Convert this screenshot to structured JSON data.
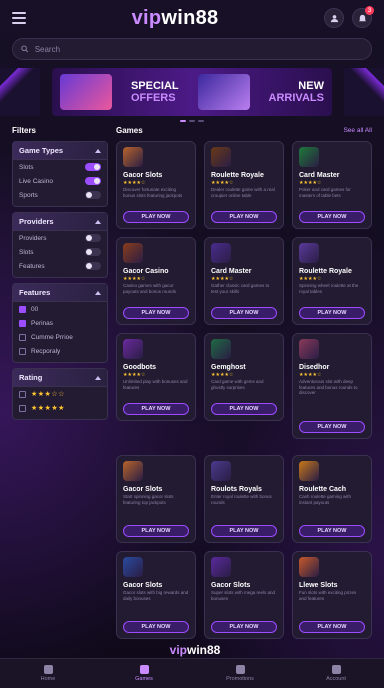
{
  "header": {
    "logo_a": "vip",
    "logo_b": "win88",
    "notif_count": "3"
  },
  "search": {
    "placeholder": "Search"
  },
  "banner": {
    "left_line1": "SPECIAL",
    "left_line2": "OFFERS",
    "right_line1": "NEW",
    "right_line2": "ARRIVALS"
  },
  "filters": {
    "title": "Filters",
    "game_types": {
      "title": "Game Types",
      "items": [
        {
          "label": "Slots",
          "on": true
        },
        {
          "label": "Live Casino",
          "on": true
        },
        {
          "label": "Sports",
          "on": false
        }
      ]
    },
    "providers": {
      "title": "Providers",
      "items": [
        {
          "label": "Providers",
          "on": false
        },
        {
          "label": "Slots",
          "on": false
        },
        {
          "label": "Features",
          "on": false
        }
      ]
    },
    "features": {
      "title": "Features",
      "items": [
        {
          "label": "00",
          "checked": true
        },
        {
          "label": "Perinas",
          "checked": true
        },
        {
          "label": "Cumme Prrioe",
          "checked": false
        },
        {
          "label": "Recporaly",
          "checked": false
        }
      ]
    },
    "rating": {
      "title": "Rating",
      "items": [
        {
          "stars": "★★★☆☆"
        },
        {
          "stars": "★★★★★"
        }
      ]
    }
  },
  "games": {
    "title": "Games",
    "see_all": "See all All",
    "play_label": "PLAY NOW",
    "cards": [
      {
        "name": "Gacor Slots",
        "rating": "★★★★☆",
        "desc": "Discover fortunate exciting bonus slots featuring jackpots",
        "color": "#b8642a"
      },
      {
        "name": "Roulette Royale",
        "rating": "★★★★☆",
        "desc": "Dealer roulette game with a real croupier online table",
        "color": "#6a3a18"
      },
      {
        "name": "Card Master",
        "rating": "★★★★☆",
        "desc": "Poker and card games for masters of table bets",
        "color": "#1e7a3a"
      },
      {
        "name": "Gacor Casino",
        "rating": "★★★★☆",
        "desc": "Casino games with gacor payouts and bonus rounds",
        "color": "#8a3c1c"
      },
      {
        "name": "Card Master",
        "rating": "★★★★☆",
        "desc": "Gather classic card games to test your skills",
        "color": "#4a2c8e"
      },
      {
        "name": "Roulette Royale",
        "rating": "★★★★☆",
        "desc": "Spinning wheel roulette at the royal tables",
        "color": "#5a3a9a"
      },
      {
        "name": "Goodbots",
        "rating": "★★★★☆",
        "desc": "Unlimited play with bonuses and features",
        "color": "#6a2a9e"
      },
      {
        "name": "Gemghost",
        "rating": "★★★★☆",
        "desc": "Card game with gems and ghostly surprises",
        "color": "#1f6a44"
      },
      {
        "name": "Disedhor",
        "rating": "★★★★☆",
        "desc": "Adventurous slot with deep features and bonus rounds to discover",
        "color": "#8a3a5a"
      },
      {
        "name": "Gacor Slots",
        "rating": "",
        "desc": "Start spinning gacor slots featuring top jackpots",
        "color": "#b8642a"
      },
      {
        "name": "Roulots Royals",
        "rating": "",
        "desc": "Enter royal roulette with bonus rounds",
        "color": "#4a3a8e"
      },
      {
        "name": "Roulette Cach",
        "rating": "",
        "desc": "Cash roulette gaming with instant payouts",
        "color": "#c7781a"
      },
      {
        "name": "Gacor Slots",
        "rating": "",
        "desc": "Gacor slots with big rewards and daily bonuses",
        "color": "#2a4aa0"
      },
      {
        "name": "Gacor Slots",
        "rating": "",
        "desc": "Super slots with mega reels and bonuses",
        "color": "#5a2a9e"
      },
      {
        "name": "Llewe Slots",
        "rating": "",
        "desc": "Fun slots with exciting prizes and features",
        "color": "#c75a2a"
      }
    ]
  },
  "footer_logo": {
    "a": "vip",
    "b": "win88"
  },
  "bottom_nav": [
    {
      "label": "Home",
      "active": false
    },
    {
      "label": "Games",
      "active": true
    },
    {
      "label": "Promotions",
      "active": false
    },
    {
      "label": "Account",
      "active": false
    }
  ]
}
